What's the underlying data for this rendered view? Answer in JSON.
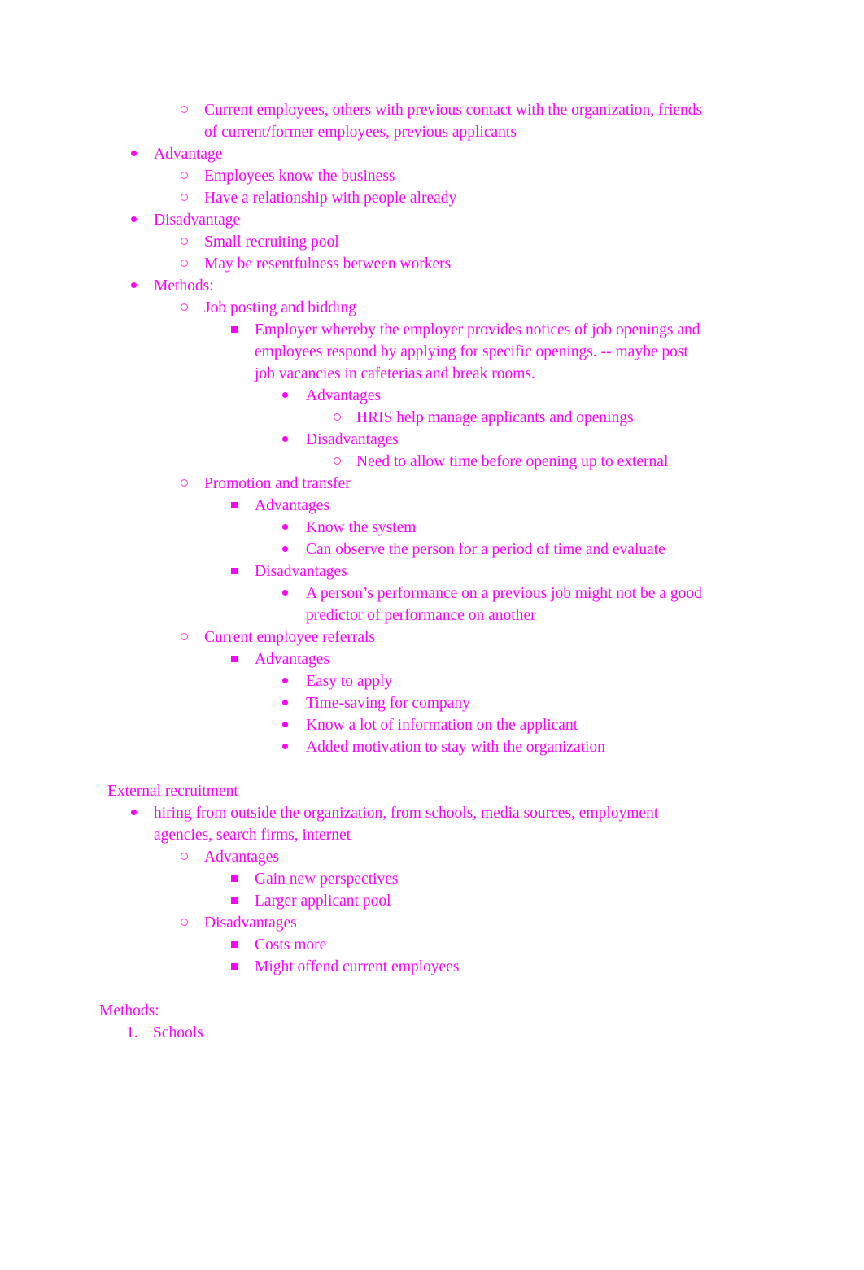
{
  "document": {
    "text_color": "#ff00ff",
    "background_color": "#ffffff",
    "font_style": "serif"
  },
  "bullet_glyphs": {
    "level1": "filled-disc",
    "level2": "hollow-circle",
    "level3": "filled-square",
    "level4": "filled-disc",
    "level5": "hollow-circle",
    "numbered": "decimal"
  },
  "outline": [
    {
      "level": 2,
      "marker": "circle",
      "text": "Current employees, others with previous contact with the organization, friends of current/former employees, previous applicants"
    },
    {
      "level": 1,
      "marker": "disc",
      "text": "Advantage"
    },
    {
      "level": 2,
      "marker": "circle",
      "text": "Employees know the business"
    },
    {
      "level": 2,
      "marker": "circle",
      "text": "Have a relationship with people already"
    },
    {
      "level": 1,
      "marker": "disc",
      "text": "Disadvantage"
    },
    {
      "level": 2,
      "marker": "circle",
      "text": "Small recruiting pool"
    },
    {
      "level": 2,
      "marker": "circle",
      "text": "May be resentfulness between workers"
    },
    {
      "level": 1,
      "marker": "disc",
      "text": "Methods:"
    },
    {
      "level": 2,
      "marker": "circle",
      "text": "Job posting and bidding"
    },
    {
      "level": 3,
      "marker": "square",
      "text": "Employer whereby the employer provides notices of job openings and employees respond by applying for specific openings. -- maybe post job vacancies in cafeterias and break rooms."
    },
    {
      "level": 4,
      "marker": "disc",
      "text": "Advantages"
    },
    {
      "level": 5,
      "marker": "circle",
      "text": "HRIS help manage applicants and openings"
    },
    {
      "level": 4,
      "marker": "disc",
      "text": "Disadvantages"
    },
    {
      "level": 5,
      "marker": "circle",
      "text": "Need to allow time before opening up to external"
    },
    {
      "level": 2,
      "marker": "circle",
      "text": "Promotion and transfer"
    },
    {
      "level": 3,
      "marker": "square",
      "text": "Advantages"
    },
    {
      "level": 4,
      "marker": "disc",
      "text": "Know the system"
    },
    {
      "level": 4,
      "marker": "disc",
      "text": "Can observe the person for a period of time and evaluate"
    },
    {
      "level": 3,
      "marker": "square",
      "text": "Disadvantages"
    },
    {
      "level": 4,
      "marker": "disc",
      "text": "A person’s performance on a previous job might not be a good predictor of performance on another"
    },
    {
      "level": 2,
      "marker": "circle",
      "text": "Current employee referrals"
    },
    {
      "level": 3,
      "marker": "square",
      "text": "Advantages"
    },
    {
      "level": 4,
      "marker": "disc",
      "text": "Easy to apply"
    },
    {
      "level": 4,
      "marker": "disc",
      "text": "Time-saving for company"
    },
    {
      "level": 4,
      "marker": "disc",
      "text": "Know a lot of information on the applicant"
    },
    {
      "level": 4,
      "marker": "disc",
      "text": "Added motivation to stay with the organization"
    }
  ],
  "external_section": {
    "heading": "External recruitment",
    "items": [
      {
        "level": 1,
        "marker": "disc",
        "text": "hiring from outside the organization, from schools, media sources, employment agencies, search firms, internet"
      },
      {
        "level": 2,
        "marker": "circle",
        "text": "Advantages"
      },
      {
        "level": 3,
        "marker": "square",
        "text": "Gain new perspectives"
      },
      {
        "level": 3,
        "marker": "square",
        "text": "Larger applicant pool"
      },
      {
        "level": 2,
        "marker": "circle",
        "text": "Disadvantages"
      },
      {
        "level": 3,
        "marker": "square",
        "text": "Costs more"
      },
      {
        "level": 3,
        "marker": "square",
        "text": "Might offend current employees"
      }
    ]
  },
  "methods_section": {
    "heading": "Methods:",
    "numbered_items": [
      {
        "number": "1.",
        "text": "Schools"
      }
    ]
  }
}
